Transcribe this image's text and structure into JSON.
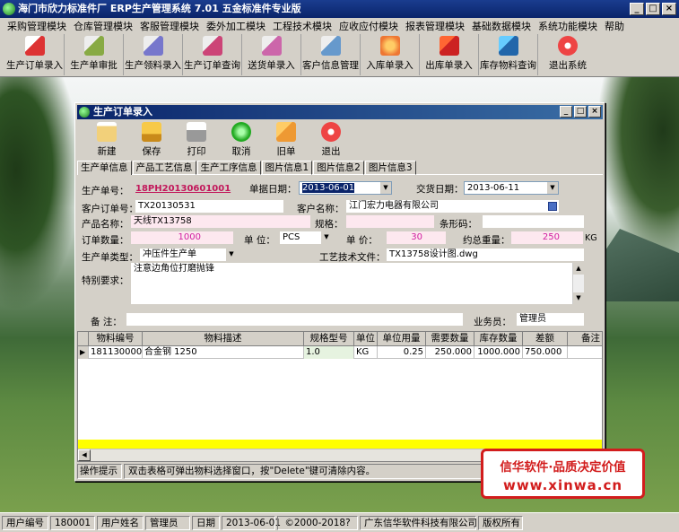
{
  "app": {
    "title": "海门市欣力标准件厂 ERP生产管理系统  7.01 五金标准件专业版"
  },
  "menu": [
    "采购管理模块",
    "仓库管理模块",
    "客服管理模块",
    "委外加工模块",
    "工程技术模块",
    "应收应付模块",
    "报表管理模块",
    "基础数据模块",
    "系统功能模块",
    "帮助"
  ],
  "toolbar": [
    {
      "label": "生产订单录入",
      "icon": "pdf-doc-icon"
    },
    {
      "label": "生产单审批",
      "icon": "approve-doc-icon"
    },
    {
      "label": "生产领料录入",
      "icon": "material-pick-icon"
    },
    {
      "label": "生产订单查询",
      "icon": "order-query-icon"
    },
    {
      "label": "送货单录入",
      "icon": "delivery-doc-icon"
    },
    {
      "label": "客户信息管理",
      "icon": "customer-icon"
    },
    {
      "label": "入库单录入",
      "icon": "stock-in-icon"
    },
    {
      "label": "出库单录入",
      "icon": "stock-out-icon"
    },
    {
      "label": "库存物料查询",
      "icon": "inventory-query-icon"
    },
    {
      "label": "退出系统",
      "icon": "exit-icon"
    }
  ],
  "child": {
    "title": "生产订单录入",
    "tools": [
      "新建",
      "保存",
      "打印",
      "取消",
      "旧单",
      "退出"
    ],
    "tabs": [
      "生产单信息",
      "产品工艺信息",
      "生产工序信息",
      "图片信息1",
      "图片信息2",
      "图片信息3"
    ]
  },
  "form": {
    "order_no_label": "生产单号：",
    "order_no": "18PH20130601001",
    "bill_date_label": "单据日期：",
    "bill_date": "2013-06-01",
    "delivery_date_label": "交货日期：",
    "delivery_date": "2013-06-11",
    "cust_order_label": "客户订单号：",
    "cust_order": "TX20130531",
    "cust_name_label": "客户名称：",
    "cust_name": "江门宏力电器有限公司",
    "product_label": "产品名称：",
    "product": "天线TX13758",
    "spec_label": "规格：",
    "spec": "",
    "barcode_label": "条形码：",
    "barcode": "",
    "qty_label": "订单数量：",
    "qty": "1000",
    "unit_label": "单 位：",
    "unit": "PCS",
    "price_label": "单 价：",
    "price": "30",
    "weight_label": "约总重量：",
    "weight": "250",
    "weight_unit": "KG",
    "type_label": "生产单类型：",
    "type": "冲压件生产单",
    "craft_label": "工艺技术文件：",
    "craft": "TX13758设计图.dwg",
    "special_label": "特别要求：",
    "special": "注意边角位打磨抛锋",
    "remark_label": "备  注：",
    "remark": "",
    "sales_label": "业务员：",
    "sales": "管理员"
  },
  "grid": {
    "headers": [
      "物料编号",
      "物料描述",
      "规格型号",
      "单位",
      "单位用量",
      "需要数量",
      "库存数量",
      "差额",
      "备注"
    ],
    "rows": [
      [
        "1811300001",
        "合金钢 1250",
        "1.0",
        "KG",
        "0.25",
        "250.000",
        "1000.000",
        "750.000",
        ""
      ]
    ]
  },
  "hint": {
    "label": "操作提示",
    "text": "双击表格可弹出物料选择窗口，按\"Delete\"键可清除内容。"
  },
  "ad": {
    "line1": "信华软件·品质决定价值",
    "line2": "www.xinwa.cn"
  },
  "status": {
    "user_no_label": "用户编号",
    "user_no": "180001",
    "user_name_label": "用户姓名",
    "user_name": "管理员",
    "date_label": "日期",
    "date": "2013-06-01",
    "copyright": "©2000-2018?",
    "company": "广东信华软件科技有限公司",
    "rights": "版权所有"
  }
}
